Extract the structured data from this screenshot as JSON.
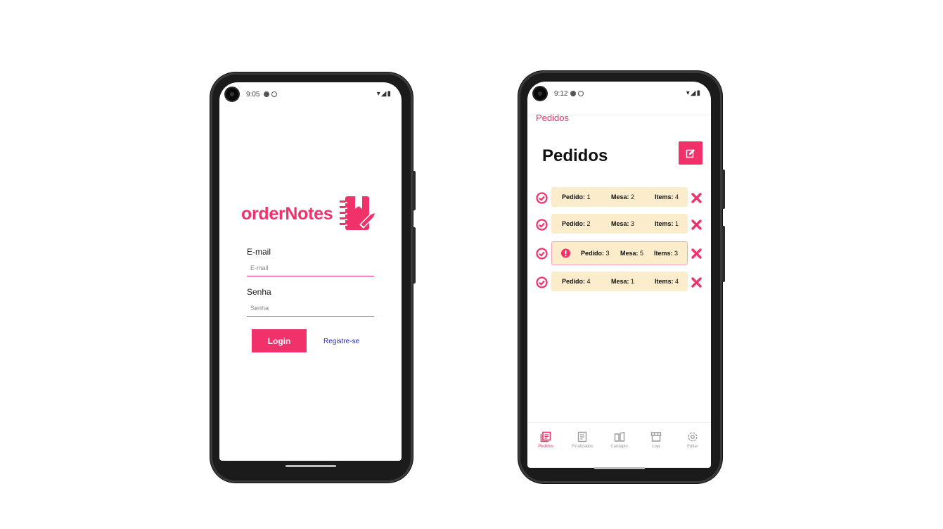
{
  "colors": {
    "accent": "#f0316a",
    "card": "#fbeccb",
    "link": "#2020d6"
  },
  "login_screen": {
    "status": {
      "time": "9:05"
    },
    "brand": {
      "name": "orderNotes",
      "logo_icon": "notebook-pen-icon"
    },
    "email": {
      "label": "E-mail",
      "placeholder": "E-mail"
    },
    "password": {
      "label": "Senha",
      "placeholder": "Senha"
    },
    "login_button": "Login",
    "register_link": "Registre-se"
  },
  "pedidos_screen": {
    "status": {
      "time": "9:12"
    },
    "appbar_title": "Pedidos",
    "page_title": "Pedidos",
    "new_order_icon": "edit-square-icon",
    "orders": [
      {
        "pedido_label": "Pedido:",
        "pedido": "1",
        "mesa_label": "Mesa:",
        "mesa": "2",
        "items_label": "Items:",
        "items": "4",
        "alert": false
      },
      {
        "pedido_label": "Pedido:",
        "pedido": "2",
        "mesa_label": "Mesa:",
        "mesa": "3",
        "items_label": "Items:",
        "items": "1",
        "alert": false
      },
      {
        "pedido_label": "Pedido:",
        "pedido": "3",
        "mesa_label": "Mesa:",
        "mesa": "5",
        "items_label": "Items:",
        "items": "3",
        "alert": true
      },
      {
        "pedido_label": "Pedido:",
        "pedido": "4",
        "mesa_label": "Mesa:",
        "mesa": "1",
        "items_label": "Items:",
        "items": "4",
        "alert": false
      }
    ],
    "nav": [
      {
        "label": "Pedidos",
        "icon": "orders-icon",
        "active": true
      },
      {
        "label": "Finalizados",
        "icon": "finished-icon",
        "active": false
      },
      {
        "label": "Cardápio",
        "icon": "menu-book-icon",
        "active": false
      },
      {
        "label": "Loja",
        "icon": "store-icon",
        "active": false
      },
      {
        "label": "Editar",
        "icon": "settings-icon",
        "active": false
      }
    ]
  }
}
